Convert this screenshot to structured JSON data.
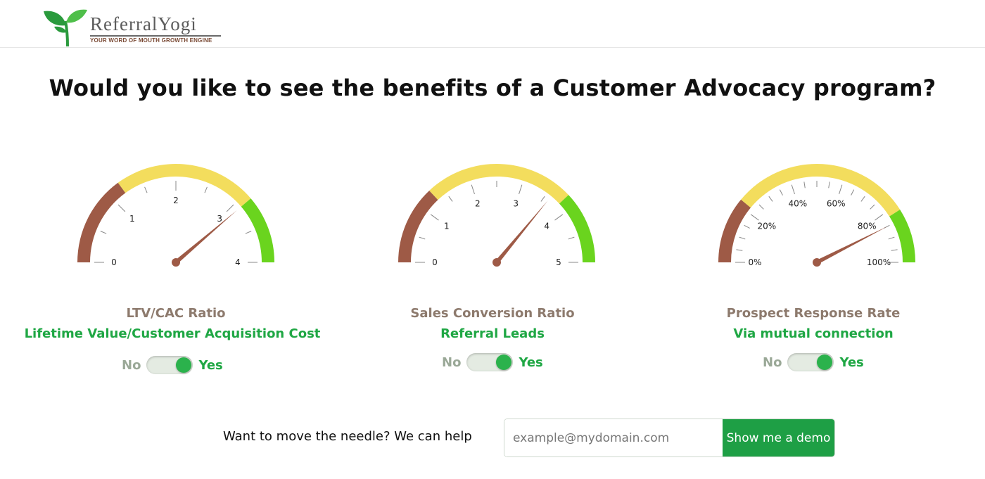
{
  "brand": {
    "name": "ReferralYogi",
    "tagline": "YOUR WORD OF MOUTH GROWTH ENGINE",
    "icon": "seedling-icon",
    "colors": {
      "leaf": "#2a9a3d",
      "tagline": "#7a4a35"
    }
  },
  "headline": "Would you like to see the benefits of a Customer Advocacy program?",
  "colors": {
    "red_zone": "#9e5a46",
    "yellow_zone": "#f3dd5d",
    "green_zone": "#6ad41e",
    "needle": "#9e5a46",
    "accent_green": "#1fa744",
    "title_brown": "#8d7a6d"
  },
  "gauges": [
    {
      "title": "LTV/CAC Ratio",
      "subtitle": "Lifetime Value/Customer Acquisition Cost",
      "min": 0,
      "max": 4,
      "value": 3.1,
      "major_ticks": [
        "0",
        "1",
        "2",
        "3",
        "4"
      ],
      "minor_per_major": 1,
      "zones": [
        {
          "color": "red",
          "from": 0,
          "to": 1.2
        },
        {
          "color": "yellow",
          "from": 1.2,
          "to": 3.1
        },
        {
          "color": "green",
          "from": 3.1,
          "to": 4
        }
      ],
      "toggle": {
        "off_label": "No",
        "on_label": "Yes",
        "state": "on"
      }
    },
    {
      "title": "Sales Conversion Ratio",
      "subtitle": "Referral Leads",
      "min": 0,
      "max": 5,
      "value": 3.6,
      "major_ticks": [
        "0",
        "1",
        "2",
        "3",
        "4",
        "5"
      ],
      "minor_per_major": 1,
      "zones": [
        {
          "color": "red",
          "from": 0,
          "to": 1.3
        },
        {
          "color": "yellow",
          "from": 1.3,
          "to": 3.8
        },
        {
          "color": "green",
          "from": 3.8,
          "to": 5
        }
      ],
      "toggle": {
        "off_label": "No",
        "on_label": "Yes",
        "state": "on"
      }
    },
    {
      "title": "Prospect Response Rate",
      "subtitle": "Via mutual connection",
      "min": 0,
      "max": 100,
      "value": 85,
      "major_ticks": [
        "0%",
        "20%",
        "40%",
        "60%",
        "80%",
        "100%"
      ],
      "minor_per_major": 3,
      "zones": [
        {
          "color": "red",
          "from": 0,
          "to": 22
        },
        {
          "color": "yellow",
          "from": 22,
          "to": 82
        },
        {
          "color": "green",
          "from": 82,
          "to": 100
        }
      ],
      "toggle": {
        "off_label": "No",
        "on_label": "Yes",
        "state": "on"
      }
    }
  ],
  "cta": {
    "text": "Want to move the needle? We can help",
    "email_placeholder": "example@mydomain.com",
    "button_label": "Show me a demo"
  }
}
